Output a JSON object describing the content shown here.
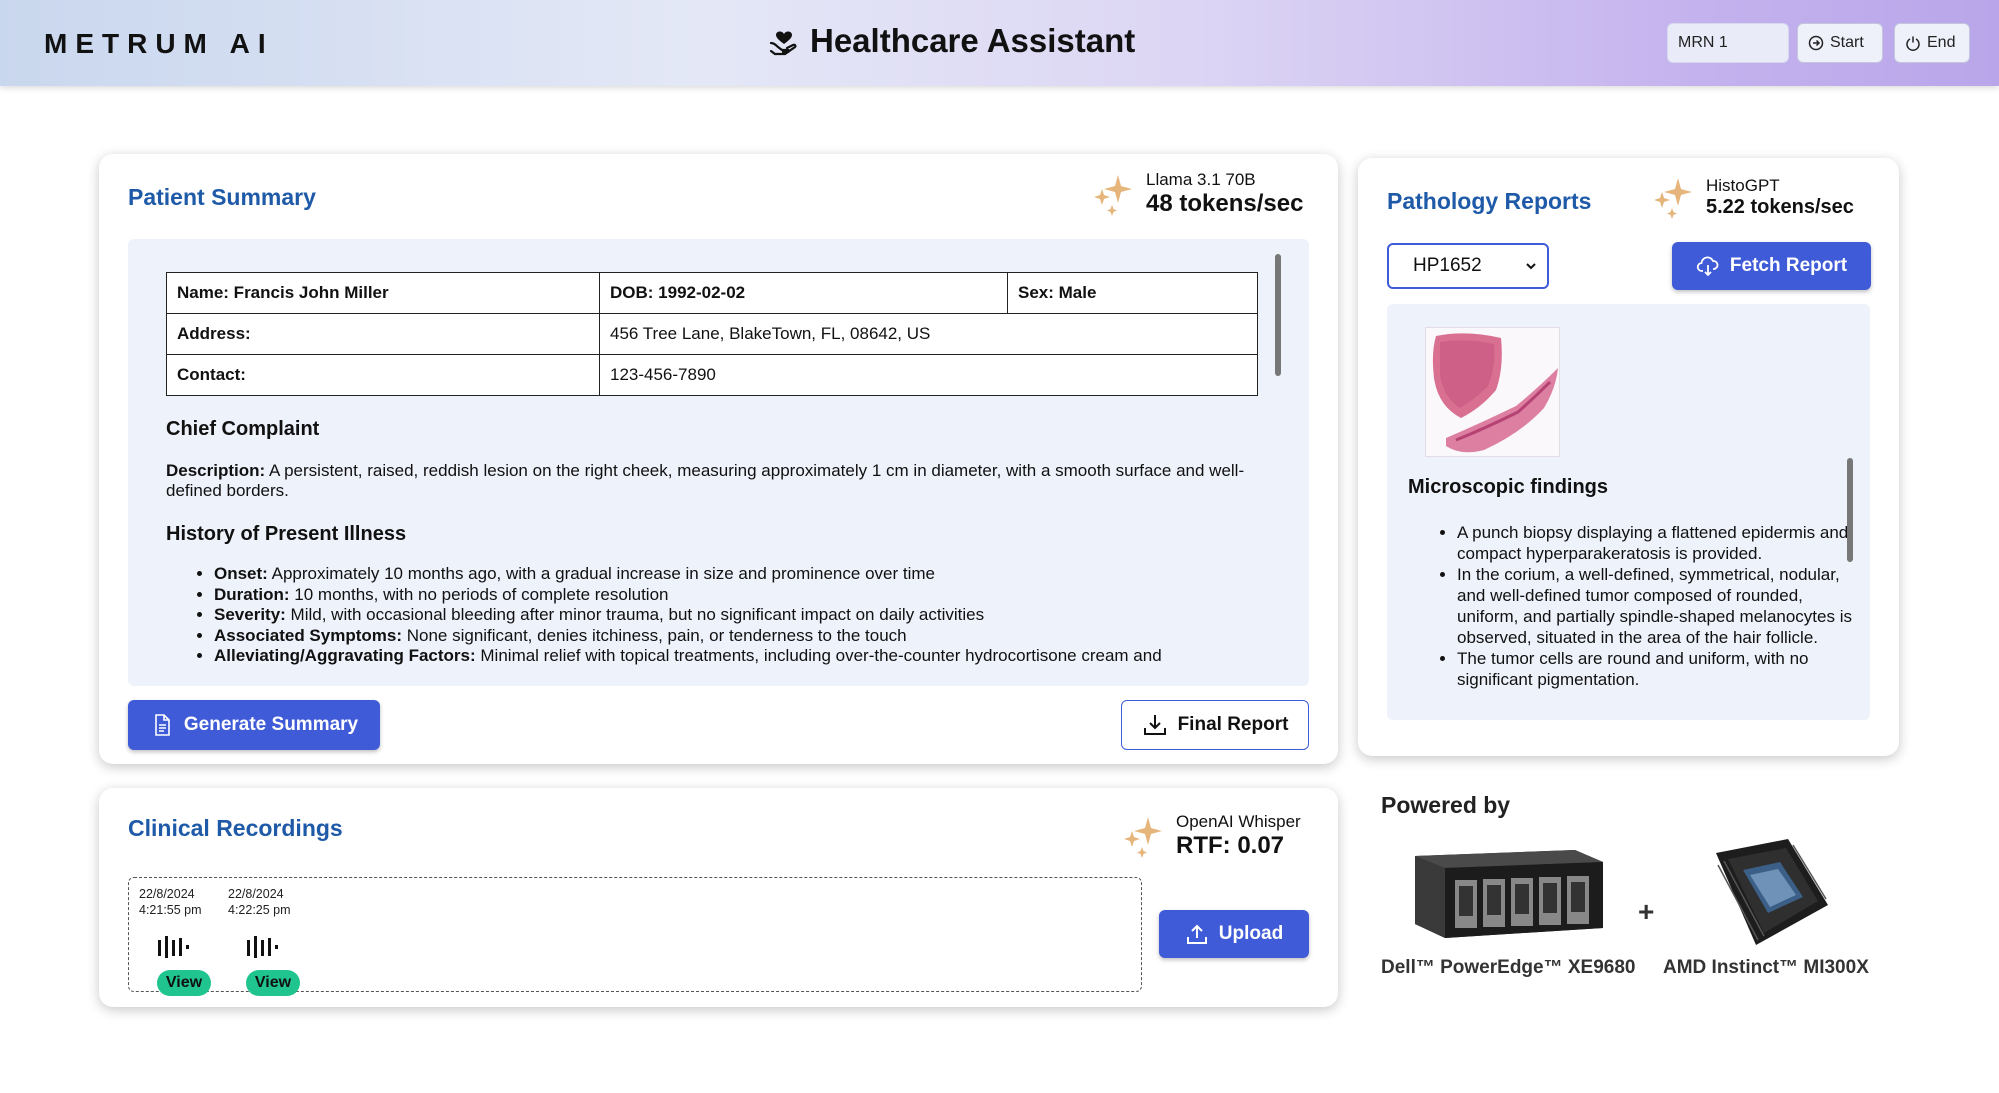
{
  "header": {
    "logo": "METRUM AI",
    "title": "Healthcare Assistant",
    "mrn_value": "MRN 1",
    "start_label": "Start",
    "end_label": "End"
  },
  "patient_summary": {
    "title": "Patient Summary",
    "model_name": "Llama 3.1 70B",
    "model_speed": "48 tokens/sec",
    "info": {
      "name": "Name: Francis John Miller",
      "dob": "DOB: 1992-02-02",
      "sex": "Sex: Male",
      "address_label": "Address:",
      "address_value": "456 Tree Lane, BlakeTown, FL, 08642, US",
      "contact_label": "Contact:",
      "contact_value": "123-456-7890"
    },
    "chief_complaint_heading": "Chief Complaint",
    "description_label": "Description:",
    "description_text": " A persistent, raised, reddish lesion on the right cheek, measuring approximately 1 cm in diameter, with a smooth surface and well-defined borders.",
    "hpi_heading": "History of Present Illness",
    "hpi_items": [
      {
        "label": "Onset:",
        "text": " Approximately 10 months ago, with a gradual increase in size and prominence over time"
      },
      {
        "label": "Duration:",
        "text": " 10 months, with no periods of complete resolution"
      },
      {
        "label": "Severity:",
        "text": " Mild, with occasional bleeding after minor trauma, but no significant impact on daily activities"
      },
      {
        "label": "Associated Symptoms:",
        "text": " None significant, denies itchiness, pain, or tenderness to the touch"
      },
      {
        "label": "Alleviating/Aggravating Factors:",
        "text": " Minimal relief with topical treatments, including over-the-counter hydrocortisone cream and"
      }
    ],
    "generate_label": "Generate Summary",
    "final_report_label": "Final Report"
  },
  "pathology": {
    "title": "Pathology Reports",
    "model_name": "HistoGPT",
    "model_speed": "5.22 tokens/sec",
    "selected_report": "HP1652",
    "fetch_label": "Fetch Report",
    "findings_heading": "Microscopic findings",
    "findings": [
      "A punch biopsy displaying a flattened epidermis and compact hyperparakeratosis is provided.",
      "In the corium, a well-defined, symmetrical, nodular, and well-defined tumor composed of rounded, uniform, and partially spindle-shaped melanocytes is observed, situated in the area of the hair follicle.",
      "The tumor cells are round and uniform, with no significant pigmentation."
    ]
  },
  "recordings": {
    "title": "Clinical Recordings",
    "model_name": "OpenAI Whisper",
    "model_speed": "RTF: 0.07",
    "items": [
      {
        "date": "22/8/2024",
        "time": "4:21:55 pm",
        "view_label": "View"
      },
      {
        "date": "22/8/2024",
        "time": "4:22:25 pm",
        "view_label": "View"
      }
    ],
    "upload_label": "Upload"
  },
  "powered_by": {
    "heading": "Powered by",
    "server_label": "Dell™ PowerEdge™ XE9680",
    "plus": "+",
    "gpu_label": "AMD Instinct™ MI300X"
  }
}
